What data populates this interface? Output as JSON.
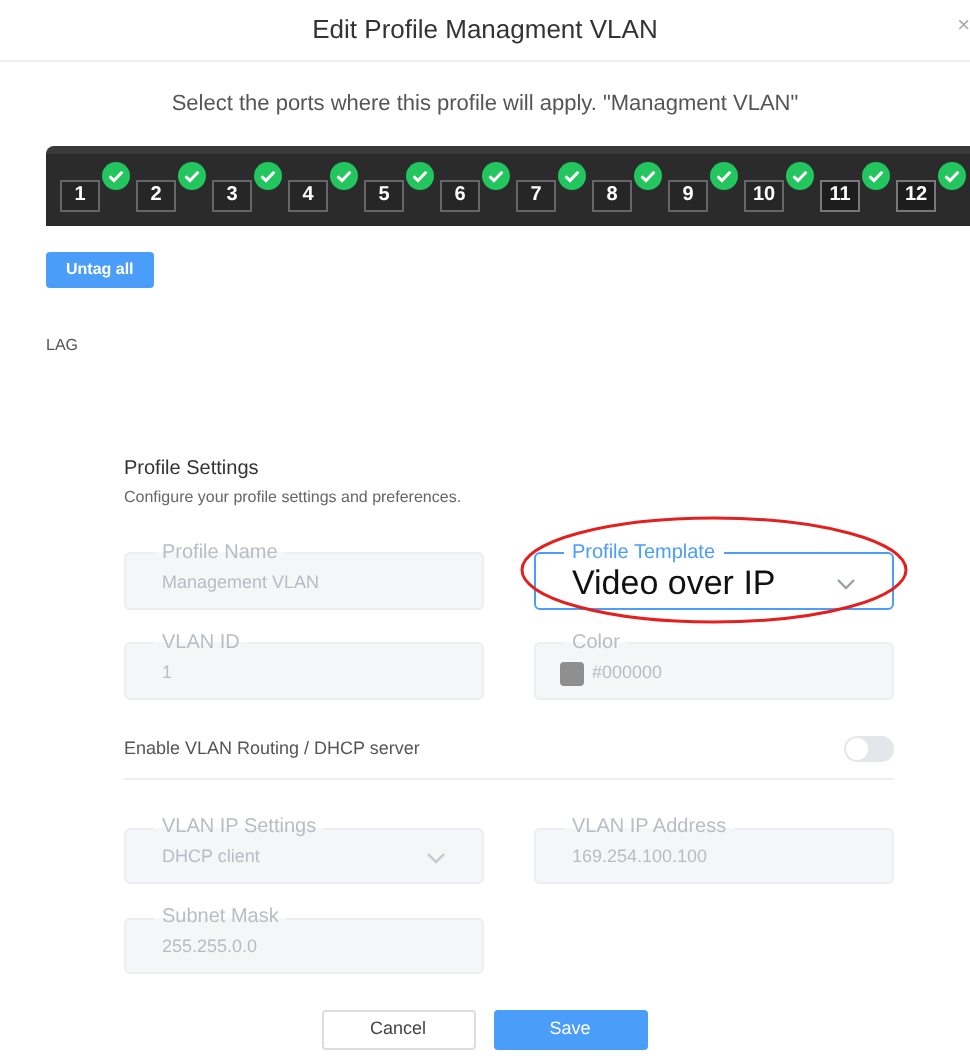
{
  "dialog": {
    "title": "Edit Profile Managment VLAN",
    "close": "×"
  },
  "instructions": "Select the ports where this profile will apply. \"Managment VLAN\"",
  "ports": [
    {
      "label": "1",
      "kind": "rj45",
      "checked": true
    },
    {
      "label": "2",
      "kind": "rj45",
      "checked": true
    },
    {
      "label": "3",
      "kind": "rj45",
      "checked": true
    },
    {
      "label": "4",
      "kind": "rj45",
      "checked": true
    },
    {
      "label": "5",
      "kind": "rj45",
      "checked": true
    },
    {
      "label": "6",
      "kind": "rj45",
      "checked": true
    },
    {
      "label": "7",
      "kind": "rj45",
      "checked": true
    },
    {
      "label": "8",
      "kind": "rj45",
      "checked": true
    },
    {
      "label": "9",
      "kind": "rj45",
      "checked": true
    },
    {
      "label": "10",
      "kind": "rj45",
      "checked": true
    },
    {
      "label": "11",
      "kind": "sfp",
      "checked": true
    },
    {
      "label": "12",
      "kind": "sfp",
      "checked": true
    }
  ],
  "untag_button": "Untag all",
  "lag_label": "LAG",
  "settings": {
    "title": "Profile Settings",
    "subtitle": "Configure your profile settings and preferences."
  },
  "fields_top": [
    {
      "label": "Profile Name",
      "value": "Management VLAN",
      "kind": "input",
      "disabled": true
    },
    {
      "label": "Profile Template",
      "value": "Video over IP",
      "kind": "select",
      "disabled": false,
      "annotated": true
    },
    {
      "label": "VLAN ID",
      "value": "1",
      "kind": "input",
      "disabled": true
    },
    {
      "label": "Color",
      "value": "#000000",
      "kind": "color",
      "disabled": true
    }
  ],
  "routing_toggle": {
    "label": "Enable VLAN Routing / DHCP server",
    "on": false
  },
  "fields_bottom": [
    {
      "label": "VLAN IP Settings",
      "value": "DHCP client",
      "kind": "select",
      "disabled": true
    },
    {
      "label": "VLAN IP Address",
      "value": "169.254.100.100",
      "kind": "input",
      "disabled": true
    },
    {
      "label": "Subnet Mask",
      "value": "255.255.0.0",
      "kind": "input",
      "disabled": true
    }
  ],
  "buttons": [
    {
      "label": "Cancel",
      "kind": "secondary"
    },
    {
      "label": "Save",
      "kind": "primary"
    }
  ]
}
